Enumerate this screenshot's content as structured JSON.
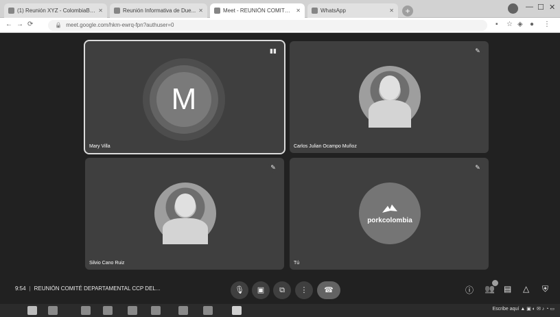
{
  "browser": {
    "tabs": [
      {
        "label": "(1) Reunión XYZ - ColombiaBDt..."
      },
      {
        "label": "Reunión Informativa de Due..."
      },
      {
        "label": "Meet - REUNIÓN COMITÉ D..."
      },
      {
        "label": "WhatsApp"
      }
    ],
    "active_tab": 2,
    "url": "meet.google.com/hkm-ewrq-fpn?authuser=0"
  },
  "meeting": {
    "participants": [
      {
        "name": "Mary Villa",
        "initial": "M",
        "kind": "letter",
        "speaking": true
      },
      {
        "name": "Carlos Julian Ocampo Muñoz",
        "kind": "photo",
        "speaking": false
      },
      {
        "name": "Silvio Cano Ruiz",
        "kind": "photo",
        "speaking": false
      },
      {
        "name": "Tú",
        "kind": "brand",
        "brand_text": "porkcolombia",
        "speaking": false
      }
    ],
    "time": "9:54",
    "title": "REUNIÓN COMITÉ DEPARTAMENTAL CCP DEL..."
  },
  "taskbar": {
    "tray_text": "Escribe aquí"
  }
}
